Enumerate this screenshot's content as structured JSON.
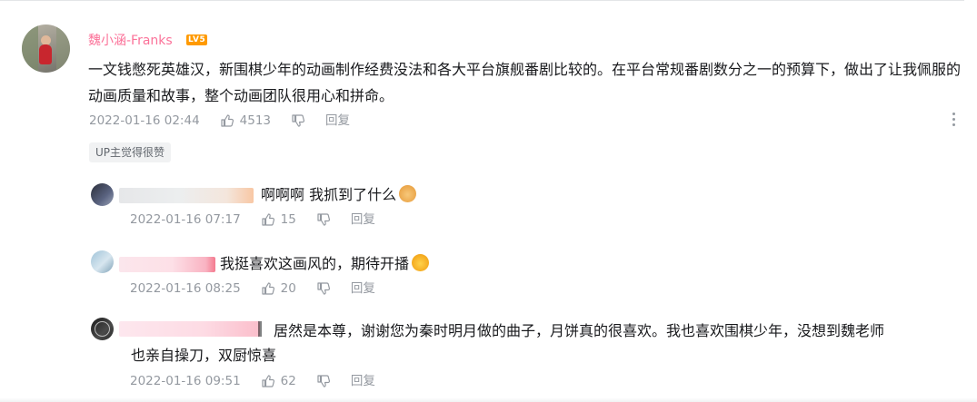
{
  "comment": {
    "username": "魏小涵-Franks",
    "level_badge": "LV5",
    "content": "一文钱憋死英雄汉，新围棋少年的动画制作经费没法和各大平台旗舰番剧比较的。在平台常规番剧数分之一的预算下，做出了让我佩服的动画质量和故事，整个动画团队很用心和拼命。",
    "date": "2022-01-16 02:44",
    "likes": "4513",
    "reply_label": "回复",
    "up_tag": "UP主觉得很赞"
  },
  "replies": [
    {
      "content": "啊啊啊 我抓到了什么",
      "emoji": "dog-face-emoji",
      "date": "2022-01-16 07:17",
      "likes": "15",
      "reply_label": "回复"
    },
    {
      "content": "我挺喜欢这画风的，期待开播",
      "emoji": "shocked-face-emoji",
      "date": "2022-01-16 08:25",
      "likes": "20",
      "reply_label": "回复"
    },
    {
      "content_line1": "居然是本尊，谢谢您为秦时明月做的曲子，月饼真的很喜欢。我也喜欢围棋少年，没想到魏老师",
      "content_line2": "也亲自操刀，双厨惊喜",
      "date": "2022-01-16 09:51",
      "likes": "62",
      "reply_label": "回复"
    }
  ],
  "colors": {
    "username": "#fb7299",
    "level_badge": "#ff9a00",
    "meta_text": "#9499a0",
    "body_text": "#18191c"
  }
}
